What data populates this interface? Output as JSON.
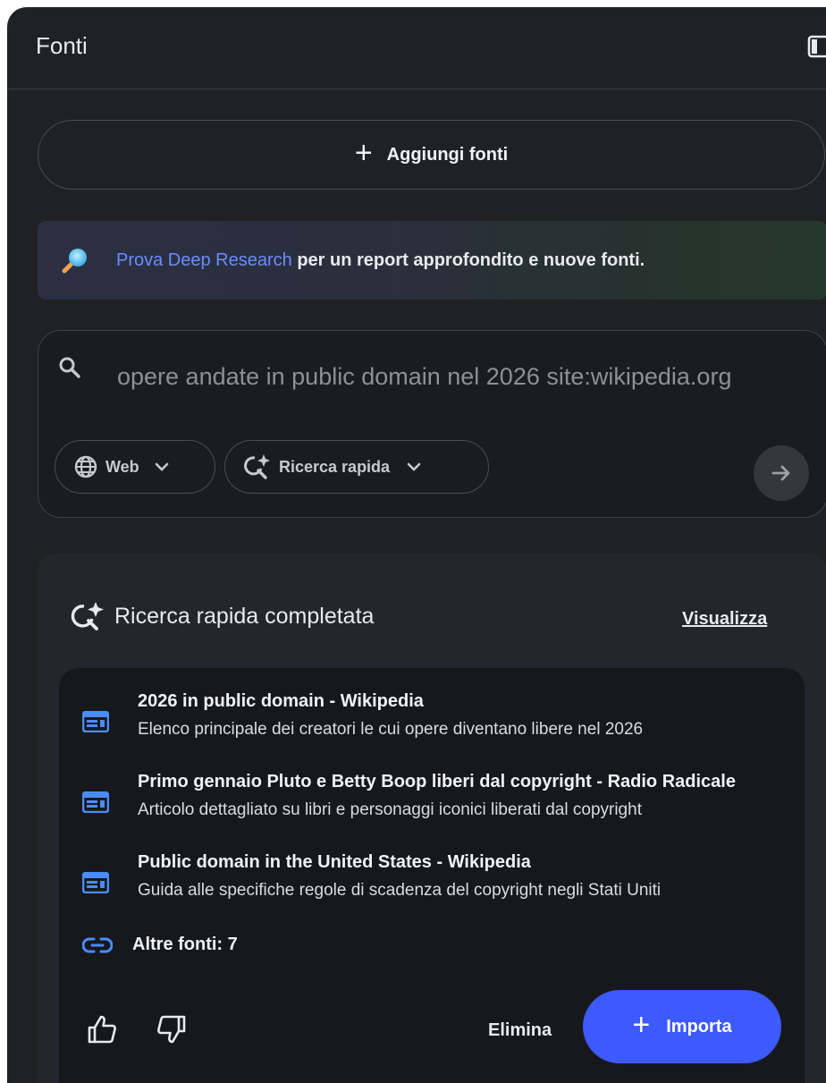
{
  "header": {
    "title": "Fonti"
  },
  "add_sources": {
    "label": "Aggiungi fonti",
    "icon": "plus-icon"
  },
  "promo": {
    "link_text": "Prova Deep Research",
    "rest_text": " per un report approfondito e nuove fonti.",
    "link_color": "#6b8cff"
  },
  "search": {
    "query": "opere andate in public domain nel 2026 site:wikipedia.org",
    "chips": [
      {
        "label": "Web",
        "icon": "globe-icon"
      },
      {
        "label": "Ricerca rapida",
        "icon": "sparkle-search-icon"
      }
    ]
  },
  "result": {
    "title": "Ricerca rapida completata",
    "view_label": "Visualizza",
    "sources": [
      {
        "title": "2026 in public domain - Wikipedia",
        "description": "Elenco principale dei creatori le cui opere diventano libere nel 2026"
      },
      {
        "title": "Primo gennaio Pluto e Betty Boop liberi dal copyright - Radio Radicale",
        "description": "Articolo dettagliato su libri e personaggi iconici liberati dal copyright"
      },
      {
        "title": "Public domain in the United States - Wikipedia",
        "description": "Guida alle specifiche regole di scadenza del copyright negli Stati Uniti"
      }
    ],
    "more_sources": "Altre fonti: 7",
    "delete_label": "Elimina",
    "import_label": "Importa",
    "accent_color": "#3d5afe",
    "source_icon_color": "#4a8cff"
  }
}
